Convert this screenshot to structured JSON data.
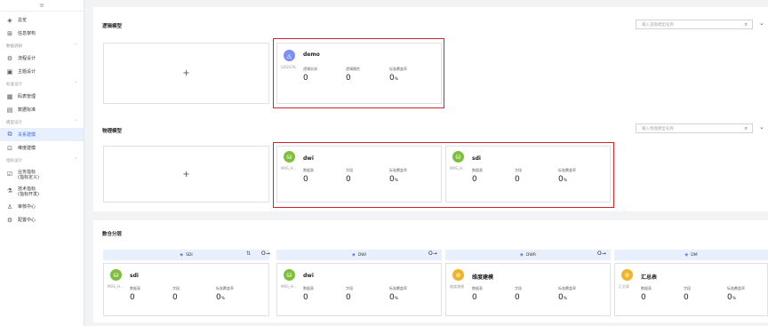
{
  "sidebar": {
    "top_icon": "≡",
    "items": [
      {
        "label": "总览",
        "icon": "layers-icon"
      },
      {
        "label": "信息架构",
        "icon": "info-arch-icon"
      }
    ],
    "groups": [
      {
        "title": "数据调研",
        "items": [
          {
            "label": "流程设计"
          },
          {
            "label": "主题设计"
          }
        ]
      },
      {
        "title": "标准设计",
        "items": [
          {
            "label": "码表管理"
          },
          {
            "label": "数据标准"
          }
        ]
      },
      {
        "title": "模型设计",
        "items": [
          {
            "label": "关系建模",
            "active": true
          },
          {
            "label": "维度建模"
          }
        ]
      },
      {
        "title": "指标设计",
        "items": [
          {
            "label1": "业务指标",
            "label2": "(指标定义)"
          },
          {
            "label1": "技术指标",
            "label2": "(指标开发)"
          }
        ]
      }
    ],
    "bottom": [
      {
        "label": "审核中心"
      },
      {
        "label": "配置中心"
      }
    ]
  },
  "logical": {
    "title": "逻辑模型",
    "search_placeholder": "输入逻辑模型名称",
    "add": "+",
    "card": {
      "name": "demo",
      "sub": "LOGICAL",
      "metrics": [
        {
          "label": "逻辑实体",
          "value": "0"
        },
        {
          "label": "逻辑属性",
          "value": "0"
        },
        {
          "label": "标准覆盖率",
          "value": "0",
          "unit": "%"
        }
      ]
    }
  },
  "physical": {
    "title": "物理模型",
    "search_placeholder": "输入物理模型名称",
    "add": "+",
    "cards": [
      {
        "name": "dwi",
        "sub": "MRS_H...",
        "metrics": [
          {
            "label": "数据表",
            "value": "0"
          },
          {
            "label": "字段",
            "value": "0"
          },
          {
            "label": "标准覆盖率",
            "value": "0",
            "unit": "%"
          }
        ]
      },
      {
        "name": "sdi",
        "sub": "MRS_H...",
        "metrics": [
          {
            "label": "数据表",
            "value": "0"
          },
          {
            "label": "字段",
            "value": "0"
          },
          {
            "label": "标准覆盖率",
            "value": "0",
            "unit": "%"
          }
        ]
      }
    ]
  },
  "layers": {
    "title": "数仓分层",
    "heads": [
      "SDI",
      "DWI",
      "DWR",
      "DM"
    ],
    "cards": [
      {
        "name": "sdi",
        "sub": "MRS_H...",
        "color": "#7dbf3b",
        "metrics": [
          {
            "label": "数据表",
            "value": "0"
          },
          {
            "label": "字段",
            "value": "0"
          },
          {
            "label": "标准覆盖率",
            "value": "0",
            "unit": "%"
          }
        ]
      },
      {
        "name": "dwi",
        "sub": "MRS_H...",
        "color": "#7dbf3b",
        "metrics": [
          {
            "label": "数据表",
            "value": "0"
          },
          {
            "label": "字段",
            "value": "0"
          },
          {
            "label": "标准覆盖率",
            "value": "0",
            "unit": "%"
          }
        ]
      },
      {
        "name": "维度建模",
        "sub": "维度建模",
        "color": "#f0b429",
        "metrics": [
          {
            "label": "数据表",
            "value": "0"
          },
          {
            "label": "字段",
            "value": "0"
          },
          {
            "label": "标准覆盖率",
            "value": "0",
            "unit": "%"
          }
        ]
      },
      {
        "name": "汇总表",
        "sub": "汇总表",
        "color": "#f0b429",
        "metrics": [
          {
            "label": "数据表",
            "value": "0"
          },
          {
            "label": "字段",
            "value": "0"
          },
          {
            "label": "标准覆盖率",
            "value": "0",
            "unit": "%"
          }
        ]
      }
    ],
    "swap": "⇅",
    "arrow": "O→"
  },
  "colors": {
    "accent": "#3c6ee8",
    "highlight": "#d2232a",
    "green": "#7dbf3b",
    "yellow": "#f0b429",
    "logical": "#7b8ff5"
  }
}
